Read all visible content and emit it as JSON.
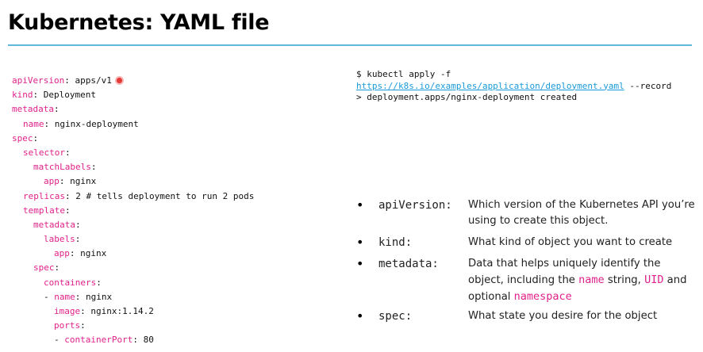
{
  "title": "Kubernetes: YAML file",
  "yaml": {
    "l1": {
      "key": "apiVersion",
      "val": " apps/v1"
    },
    "l2": {
      "key": "kind",
      "val": " Deployment"
    },
    "l3": {
      "key": "metadata",
      "val": ""
    },
    "l4": {
      "key": "name",
      "val": " nginx-deployment"
    },
    "l5": {
      "key": "spec",
      "val": ""
    },
    "l6": {
      "key": "selector",
      "val": ""
    },
    "l7": {
      "key": "matchLabels",
      "val": ""
    },
    "l8": {
      "key": "app",
      "val": " nginx"
    },
    "l9": {
      "key": "replicas",
      "val": " 2 # tells deployment to run 2 pods"
    },
    "l10": {
      "key": "template",
      "val": ""
    },
    "l11": {
      "key": "metadata",
      "val": ""
    },
    "l12": {
      "key": "labels",
      "val": ""
    },
    "l13": {
      "key": "app",
      "val": " nginx"
    },
    "l14": {
      "key": "spec",
      "val": ""
    },
    "l15": {
      "key": "containers",
      "val": ""
    },
    "l16": {
      "key": "name",
      "val": " nginx"
    },
    "l17": {
      "key": "image",
      "val": " nginx:1.14.2"
    },
    "l18": {
      "key": "ports",
      "val": ""
    },
    "l19": {
      "key": "containerPort",
      "val": " 80"
    }
  },
  "command": {
    "line1": "$ kubectl apply -f",
    "url": "https://k8s.io/examples/application/deployment.yaml",
    "flag": " --record",
    "output": "> deployment.apps/nginx-deployment created"
  },
  "bullets": {
    "b1": {
      "term": "apiVersion:",
      "desc": "Which version of the Kubernetes API you’re using to create this object."
    },
    "b2": {
      "term": "kind:",
      "desc": "What kind of object you want to create"
    },
    "b3": {
      "term": "metadata:",
      "desc_a": "Data that helps uniquely identify the object, including the ",
      "name": "name",
      "desc_b": " string, ",
      "uid": "UID",
      "desc_c": " and optional ",
      "ns": "namespace"
    },
    "b4": {
      "term": "spec:",
      "desc": "What state you desire for the object"
    }
  },
  "marks": {
    "bullet": "•",
    "colon": ":",
    "dash": "- "
  },
  "colors": {
    "key": "#e0218a",
    "rule": "#5fb8d9",
    "link": "#1a9bd7",
    "dot": "#e53935"
  }
}
